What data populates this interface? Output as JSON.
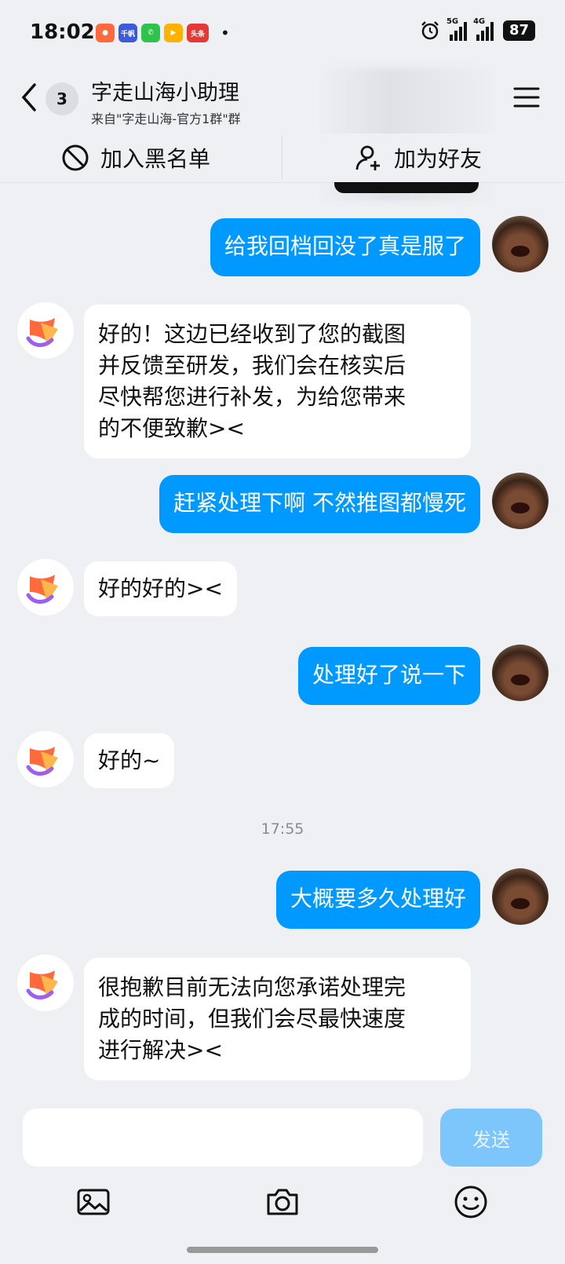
{
  "status": {
    "time": "18:02",
    "apps": [
      {
        "icon": "app-icon-1",
        "color": "#ff6a3d",
        "text": ""
      },
      {
        "icon": "app-icon-qianfan",
        "color": "#3b5bdb",
        "text": "千帆"
      },
      {
        "icon": "phone-app-icon",
        "color": "#2fc24d",
        "text": ""
      },
      {
        "icon": "video-app-icon",
        "color": "#ffb300",
        "text": ""
      },
      {
        "icon": "toutiao-app-icon",
        "color": "#e53935",
        "text": "头条"
      }
    ],
    "more_dot": "•",
    "signal1_label": "5G",
    "signal2_label": "4G",
    "battery": "87"
  },
  "header": {
    "unread_count": "3",
    "title": "字走山海小助理",
    "subtitle": "来自\"字走山海-官方1群\"群"
  },
  "actions": {
    "blacklist": "加入黑名单",
    "add_friend": "加为好友"
  },
  "messages": [
    {
      "from": "me",
      "text": "给我回档回没了真是服了"
    },
    {
      "from": "bot",
      "lines": [
        "好的！这边已经收到了您的截图",
        "并反馈至研发，我们会在核实后",
        "尽快帮您进行补发，为给您带来",
        "的不便致歉><"
      ]
    },
    {
      "from": "me",
      "text": "赶紧处理下啊  不然推图都慢死"
    },
    {
      "from": "bot",
      "lines": [
        "好的好的><"
      ]
    },
    {
      "from": "me",
      "text": "处理好了说一下"
    },
    {
      "from": "bot",
      "lines": [
        "好的~"
      ]
    },
    {
      "from": "me",
      "text": "大概要多久处理好"
    },
    {
      "from": "bot",
      "lines": [
        "很抱歉目前无法向您承诺处理完",
        "成的时间，但我们会尽最快速度",
        "进行解决><"
      ]
    }
  ],
  "timestamp": "17:55",
  "input": {
    "value": "",
    "send_label": "发送"
  },
  "colors": {
    "my_bubble": "#0099ff",
    "send_disabled": "#7dc6fb",
    "background": "#eff0f4"
  }
}
